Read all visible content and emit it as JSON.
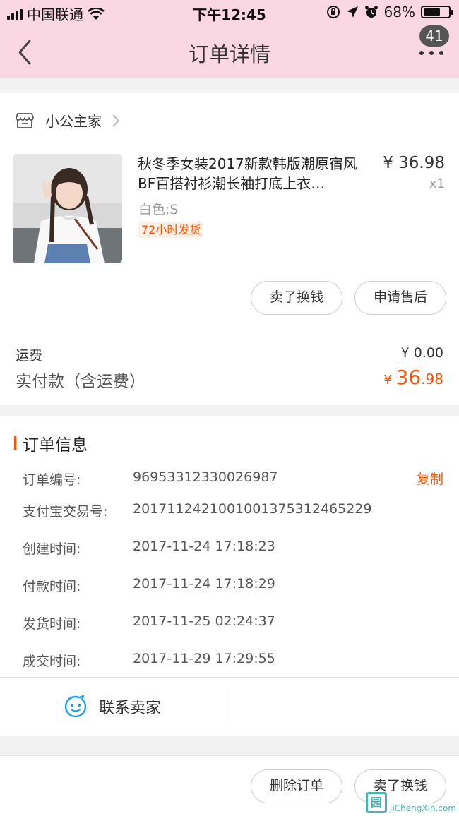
{
  "status_bar": {
    "carrier": "中国联通",
    "time": "下午12:45",
    "battery": "68%",
    "battery_level": 0.68
  },
  "nav": {
    "title": "订单详情",
    "badge": "41",
    "back_icon": "back-chevron-icon",
    "more_icon": "more-dots-icon"
  },
  "shop": {
    "name": "小公主家",
    "icon": "store-icon"
  },
  "product": {
    "title": "秋冬季女装2017新款韩版潮原宿风BF百搭衬衫潮长袖打底上衣…",
    "price": "¥ 36.98",
    "qty": "x1",
    "sku": "白色;S",
    "tag": "72小时发货"
  },
  "actions": {
    "sell_label": "卖了换钱",
    "after_sale_label": "申请售后"
  },
  "totals": {
    "shipping_label": "运费",
    "shipping_value": "¥ 0.00",
    "paid_label": "实付款（含运费）",
    "paid_currency": "¥ ",
    "paid_int": "36",
    "paid_dec": ".98"
  },
  "order_info": {
    "title": "订单信息",
    "copy_label": "复制",
    "rows": [
      {
        "label": "订单编号:",
        "value": "96953312330026987"
      },
      {
        "label": "支付宝交易号:",
        "value": "2017112421001001375312465229"
      },
      {
        "label": "创建时间:",
        "value": "2017-11-24 17:18:23"
      },
      {
        "label": "付款时间:",
        "value": "2017-11-24 17:18:29"
      },
      {
        "label": "发货时间:",
        "value": "2017-11-25 02:24:37"
      },
      {
        "label": "成交时间:",
        "value": "2017-11-29 17:29:55"
      }
    ],
    "contact_label": "联系卖家"
  },
  "bottom_bar": {
    "delete_label": "删除订单",
    "sell_label": "卖了换钱"
  },
  "watermark": {
    "brand": "JiChengXin.com"
  },
  "colors": {
    "header_bg": "#fbd6e3",
    "accent": "#ff5000"
  }
}
